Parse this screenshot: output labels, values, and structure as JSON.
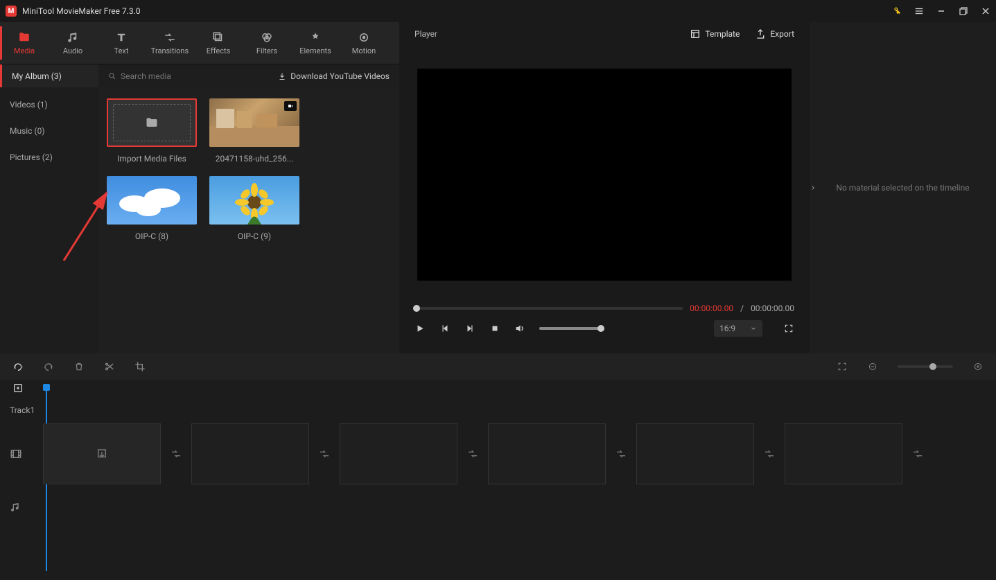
{
  "app": {
    "title": "MiniTool MovieMaker Free 7.3.0"
  },
  "toolbar": {
    "items": [
      {
        "label": "Media",
        "icon": "folder",
        "active": true
      },
      {
        "label": "Audio",
        "icon": "music"
      },
      {
        "label": "Text",
        "icon": "text"
      },
      {
        "label": "Transitions",
        "icon": "transition"
      },
      {
        "label": "Effects",
        "icon": "effects"
      },
      {
        "label": "Filters",
        "icon": "filters"
      },
      {
        "label": "Elements",
        "icon": "elements"
      },
      {
        "label": "Motion",
        "icon": "motion"
      }
    ]
  },
  "subbar": {
    "active_tab": "My Album (3)",
    "search_placeholder": "Search media",
    "download_label": "Download YouTube Videos"
  },
  "sidelist": [
    {
      "label": "Videos (1)"
    },
    {
      "label": "Music (0)"
    },
    {
      "label": "Pictures (2)"
    }
  ],
  "media": {
    "import_label": "Import Media Files",
    "items": [
      {
        "label": "20471158-uhd_256...",
        "type": "video"
      },
      {
        "label": "OIP-C (8)",
        "type": "image",
        "thumb": "clouds"
      },
      {
        "label": "OIP-C (9)",
        "type": "image",
        "thumb": "sunflower"
      }
    ]
  },
  "player": {
    "title": "Player",
    "template_label": "Template",
    "export_label": "Export",
    "time_current": "00:00:00.00",
    "time_separator": " / ",
    "time_total": "00:00:00.00",
    "aspect_ratio": "16:9"
  },
  "rightpanel": {
    "empty_text": "No material selected on the timeline"
  },
  "timeline": {
    "track_label": "Track1"
  }
}
